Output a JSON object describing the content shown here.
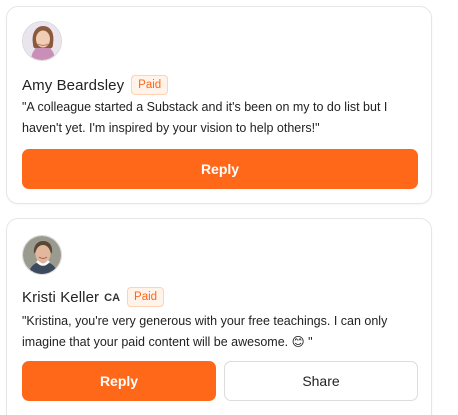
{
  "comments": [
    {
      "author": "Amy Beardsley",
      "badge": "Paid",
      "text": "\"A colleague started a Substack and it's been on my to do list but I haven't yet. I'm inspired by your vision to help others!\"",
      "reply_label": "Reply"
    },
    {
      "author": "Kristi Keller",
      "country": "CA",
      "badge": "Paid",
      "text": "\"Kristina, you're very generous with your free teachings. I can only imagine that your paid content will be awesome. 😊 \"",
      "reply_label": "Reply",
      "share_label": "Share"
    }
  ],
  "colors": {
    "accent": "#ff6719",
    "badge_bg": "#fff3ea",
    "border": "#e6e6e6"
  },
  "icons": [
    "avatar-amy",
    "avatar-kristi"
  ]
}
